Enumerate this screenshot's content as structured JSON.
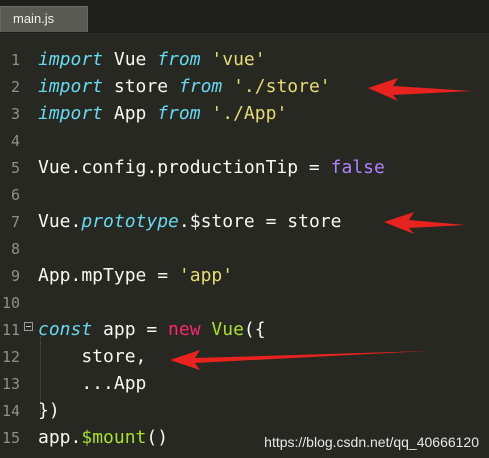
{
  "tab": {
    "label": "main.js"
  },
  "lines": [
    {
      "n": "1",
      "parts": [
        [
          "import",
          "kw-import"
        ],
        [
          " Vue ",
          ""
        ],
        [
          "from",
          "kw-import"
        ],
        [
          " ",
          ""
        ],
        [
          "'vue'",
          "str"
        ]
      ]
    },
    {
      "n": "2",
      "parts": [
        [
          "import",
          "kw-import"
        ],
        [
          " store ",
          ""
        ],
        [
          "from",
          "kw-import"
        ],
        [
          " ",
          ""
        ],
        [
          "'./store'",
          "str"
        ]
      ]
    },
    {
      "n": "3",
      "parts": [
        [
          "import",
          "kw-import"
        ],
        [
          " App ",
          ""
        ],
        [
          "from",
          "kw-import"
        ],
        [
          " ",
          ""
        ],
        [
          "'./App'",
          "str"
        ]
      ]
    },
    {
      "n": "4",
      "parts": []
    },
    {
      "n": "5",
      "parts": [
        [
          "Vue.config.productionTip = ",
          ""
        ],
        [
          "false",
          "purple"
        ]
      ]
    },
    {
      "n": "6",
      "parts": []
    },
    {
      "n": "7",
      "parts": [
        [
          "Vue.",
          ""
        ],
        [
          "prototype",
          "italic-blue"
        ],
        [
          ".$store = store",
          ""
        ]
      ]
    },
    {
      "n": "8",
      "parts": []
    },
    {
      "n": "9",
      "parts": [
        [
          "App.mpType = ",
          ""
        ],
        [
          "'app'",
          "str"
        ]
      ]
    },
    {
      "n": "10",
      "parts": []
    },
    {
      "n": "11",
      "parts": [
        [
          "const",
          "kw-const"
        ],
        [
          " app = ",
          ""
        ],
        [
          "new",
          "kw-red"
        ],
        [
          " ",
          ""
        ],
        [
          "Vue",
          "green"
        ],
        [
          "({",
          ""
        ]
      ]
    },
    {
      "n": "12",
      "parts": [
        [
          "    store,",
          ""
        ]
      ]
    },
    {
      "n": "13",
      "parts": [
        [
          "    ...App",
          ""
        ]
      ]
    },
    {
      "n": "14",
      "parts": [
        [
          "})",
          ""
        ]
      ]
    },
    {
      "n": "15",
      "parts": [
        [
          "app.",
          ""
        ],
        [
          "$mount",
          "green"
        ],
        [
          "()",
          ""
        ]
      ]
    }
  ],
  "watermark": "https://blog.csdn.net/qq_40666120",
  "colors": {
    "background": "#272822",
    "arrow": "#e8231f"
  }
}
